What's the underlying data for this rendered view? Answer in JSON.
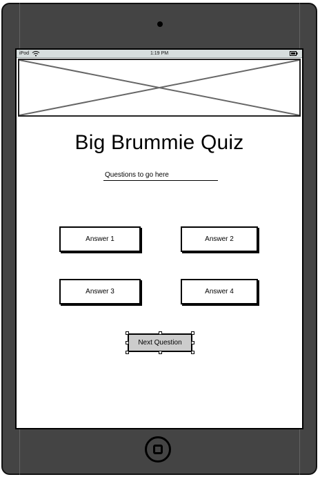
{
  "statusbar": {
    "carrier": "iPod",
    "time": "1:19 PM"
  },
  "page": {
    "title": "Big Brummie Quiz",
    "question": "Questions to go here"
  },
  "answers": [
    {
      "label": "Answer 1"
    },
    {
      "label": "Answer 2"
    },
    {
      "label": "Answer 3"
    },
    {
      "label": "Answer 4"
    }
  ],
  "next": {
    "label": "Next Question"
  },
  "colors": {
    "device_body": "#444444",
    "screen": "#ffffff",
    "statusbar": "#d7dede",
    "next_button": "#cccccc"
  }
}
